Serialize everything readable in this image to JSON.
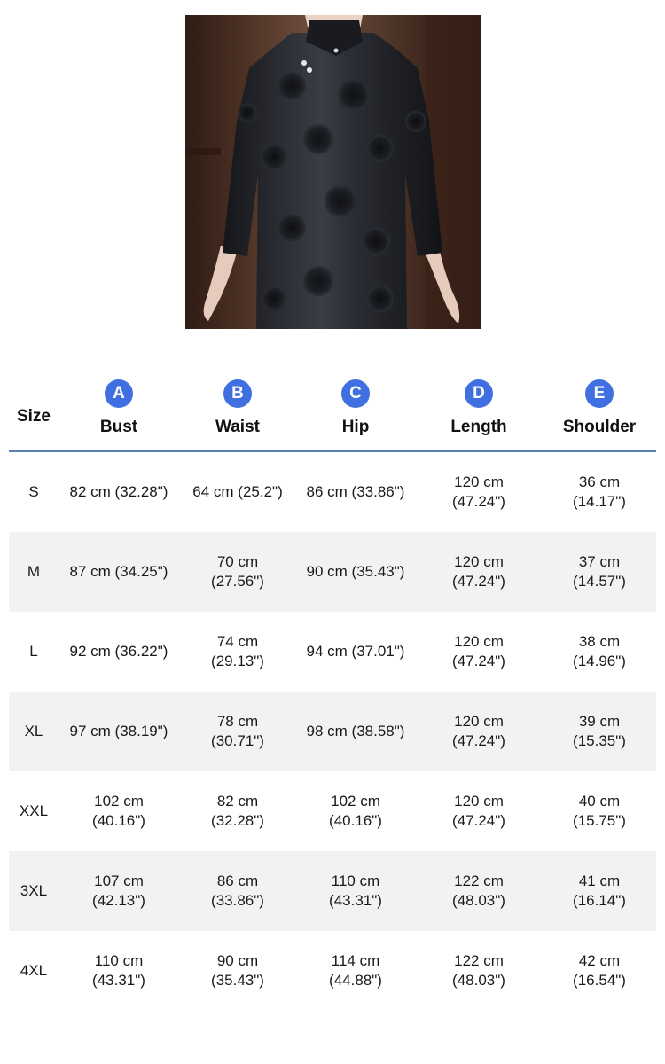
{
  "photo": {
    "alt": "Black velvet floral qipao dress"
  },
  "table": {
    "size_header": "Size",
    "columns": [
      {
        "badge": "A",
        "label": "Bust"
      },
      {
        "badge": "B",
        "label": "Waist"
      },
      {
        "badge": "C",
        "label": "Hip"
      },
      {
        "badge": "D",
        "label": "Length"
      },
      {
        "badge": "E",
        "label": "Shoulder"
      }
    ],
    "rows": [
      {
        "size": "S",
        "bust": "82 cm (32.28\")",
        "waist": "64 cm (25.2\")",
        "hip": "86 cm (33.86\")",
        "length": "120 cm (47.24\")",
        "shoulder": "36 cm (14.17\")"
      },
      {
        "size": "M",
        "bust": "87 cm (34.25\")",
        "waist": "70 cm (27.56\")",
        "hip": "90 cm (35.43\")",
        "length": "120 cm (47.24\")",
        "shoulder": "37 cm (14.57\")"
      },
      {
        "size": "L",
        "bust": "92 cm (36.22\")",
        "waist": "74 cm (29.13\")",
        "hip": "94 cm (37.01\")",
        "length": "120 cm (47.24\")",
        "shoulder": "38 cm (14.96\")"
      },
      {
        "size": "XL",
        "bust": "97 cm (38.19\")",
        "waist": "78 cm (30.71\")",
        "hip": "98 cm (38.58\")",
        "length": "120 cm (47.24\")",
        "shoulder": "39 cm (15.35\")"
      },
      {
        "size": "XXL",
        "bust": "102 cm (40.16\")",
        "waist": "82 cm (32.28\")",
        "hip": "102 cm (40.16\")",
        "length": "120 cm (47.24\")",
        "shoulder": "40 cm (15.75\")"
      },
      {
        "size": "3XL",
        "bust": "107 cm (42.13\")",
        "waist": "86 cm (33.86\")",
        "hip": "110 cm (43.31\")",
        "length": "122 cm (48.03\")",
        "shoulder": "41 cm (16.14\")"
      },
      {
        "size": "4XL",
        "bust": "110 cm (43.31\")",
        "waist": "90 cm (35.43\")",
        "hip": "114 cm (44.88\")",
        "length": "122 cm (48.03\")",
        "shoulder": "42 cm (16.54\")"
      }
    ]
  },
  "colors": {
    "badge": "#3f6fe0",
    "header_rule": "#5b7fae",
    "row_shade": "#f2f2f2"
  }
}
